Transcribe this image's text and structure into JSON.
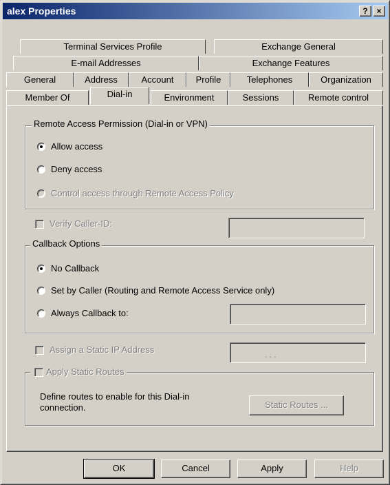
{
  "window": {
    "title": "alex Properties",
    "help_button": "?",
    "close_button": "×"
  },
  "tabs": {
    "row1": [
      "Terminal Services Profile",
      "Exchange General"
    ],
    "row2": [
      "E-mail Addresses",
      "Exchange Features"
    ],
    "row3": [
      "General",
      "Address",
      "Account",
      "Profile",
      "Telephones",
      "Organization"
    ],
    "row4": [
      "Member Of",
      "Dial-in",
      "Environment",
      "Sessions",
      "Remote control"
    ],
    "active": "Dial-in"
  },
  "remote_access": {
    "legend": "Remote Access Permission (Dial-in or VPN)",
    "allow": "Allow access",
    "deny": "Deny access",
    "policy": "Control access through Remote Access Policy",
    "selected": "allow"
  },
  "verify_caller_id": {
    "label": "Verify Caller-ID:",
    "checked": false,
    "value": ""
  },
  "callback": {
    "legend": "Callback Options",
    "none": "No Callback",
    "by_caller": "Set by Caller (Routing and Remote Access Service only)",
    "always": "Always Callback to:",
    "selected": "none",
    "value": ""
  },
  "static_ip": {
    "label": "Assign a Static IP Address",
    "checked": false,
    "dots": ".   .   ."
  },
  "static_routes": {
    "label": "Apply Static Routes",
    "checked": false,
    "description": "Define routes to enable for this Dial-in connection.",
    "button": "Static Routes ..."
  },
  "buttons": {
    "ok": "OK",
    "cancel": "Cancel",
    "apply": "Apply",
    "help": "Help"
  },
  "colors": {
    "title_gradient_start": "#0a246a",
    "title_gradient_end": "#a6caf0",
    "face": "#d4d0c8",
    "disabled_text": "#808080"
  }
}
